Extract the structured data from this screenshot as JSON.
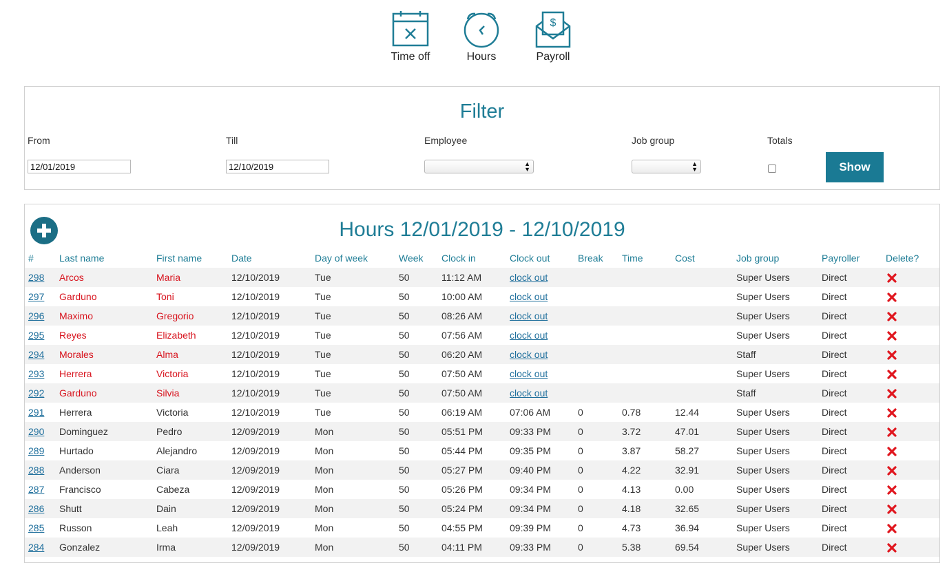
{
  "nav": [
    {
      "label": "Time off",
      "icon": "calendar-x-icon"
    },
    {
      "label": "Hours",
      "icon": "clock-icon"
    },
    {
      "label": "Payroll",
      "icon": "payroll-envelope-icon"
    }
  ],
  "filter": {
    "title": "Filter",
    "from_label": "From",
    "from_value": "12/01/2019",
    "till_label": "Till",
    "till_value": "12/10/2019",
    "employee_label": "Employee",
    "employee_value": "",
    "job_group_label": "Job group",
    "job_group_value": "",
    "totals_label": "Totals",
    "totals_checked": false,
    "show_label": "Show"
  },
  "hours": {
    "title": "Hours 12/01/2019 - 12/10/2019",
    "columns": [
      "#",
      "Last name",
      "First name",
      "Date",
      "Day of week",
      "Week",
      "Clock in",
      "Clock out",
      "Break",
      "Time",
      "Cost",
      "Job group",
      "Payroller",
      "Delete?"
    ],
    "rows": [
      {
        "id": "298",
        "last": "Arcos",
        "first": "Maria",
        "date": "12/10/2019",
        "dow": "Tue",
        "week": "50",
        "in": "11:12 AM",
        "out": "clock out",
        "brk": "",
        "time": "",
        "cost": "",
        "group": "Super Users",
        "payroller": "Direct",
        "open": true
      },
      {
        "id": "297",
        "last": "Garduno",
        "first": "Toni",
        "date": "12/10/2019",
        "dow": "Tue",
        "week": "50",
        "in": "10:00 AM",
        "out": "clock out",
        "brk": "",
        "time": "",
        "cost": "",
        "group": "Super Users",
        "payroller": "Direct",
        "open": true
      },
      {
        "id": "296",
        "last": "Maximo",
        "first": "Gregorio",
        "date": "12/10/2019",
        "dow": "Tue",
        "week": "50",
        "in": "08:26 AM",
        "out": "clock out",
        "brk": "",
        "time": "",
        "cost": "",
        "group": "Super Users",
        "payroller": "Direct",
        "open": true
      },
      {
        "id": "295",
        "last": "Reyes",
        "first": "Elizabeth",
        "date": "12/10/2019",
        "dow": "Tue",
        "week": "50",
        "in": "07:56 AM",
        "out": "clock out",
        "brk": "",
        "time": "",
        "cost": "",
        "group": "Super Users",
        "payroller": "Direct",
        "open": true
      },
      {
        "id": "294",
        "last": "Morales",
        "first": "Alma",
        "date": "12/10/2019",
        "dow": "Tue",
        "week": "50",
        "in": "06:20 AM",
        "out": "clock out",
        "brk": "",
        "time": "",
        "cost": "",
        "group": "Staff",
        "payroller": "Direct",
        "open": true
      },
      {
        "id": "293",
        "last": "Herrera",
        "first": "Victoria",
        "date": "12/10/2019",
        "dow": "Tue",
        "week": "50",
        "in": "07:50 AM",
        "out": "clock out",
        "brk": "",
        "time": "",
        "cost": "",
        "group": "Super Users",
        "payroller": "Direct",
        "open": true
      },
      {
        "id": "292",
        "last": "Garduno",
        "first": "Silvia",
        "date": "12/10/2019",
        "dow": "Tue",
        "week": "50",
        "in": "07:50 AM",
        "out": "clock out",
        "brk": "",
        "time": "",
        "cost": "",
        "group": "Staff",
        "payroller": "Direct",
        "open": true
      },
      {
        "id": "291",
        "last": "Herrera",
        "first": "Victoria",
        "date": "12/10/2019",
        "dow": "Tue",
        "week": "50",
        "in": "06:19 AM",
        "out": "07:06 AM",
        "brk": "0",
        "time": "0.78",
        "cost": "12.44",
        "group": "Super Users",
        "payroller": "Direct",
        "open": false
      },
      {
        "id": "290",
        "last": "Dominguez",
        "first": "Pedro",
        "date": "12/09/2019",
        "dow": "Mon",
        "week": "50",
        "in": "05:51 PM",
        "out": "09:33 PM",
        "brk": "0",
        "time": "3.72",
        "cost": "47.01",
        "group": "Super Users",
        "payroller": "Direct",
        "open": false
      },
      {
        "id": "289",
        "last": "Hurtado",
        "first": "Alejandro",
        "date": "12/09/2019",
        "dow": "Mon",
        "week": "50",
        "in": "05:44 PM",
        "out": "09:35 PM",
        "brk": "0",
        "time": "3.87",
        "cost": "58.27",
        "group": "Super Users",
        "payroller": "Direct",
        "open": false
      },
      {
        "id": "288",
        "last": "Anderson",
        "first": "Ciara",
        "date": "12/09/2019",
        "dow": "Mon",
        "week": "50",
        "in": "05:27 PM",
        "out": "09:40 PM",
        "brk": "0",
        "time": "4.22",
        "cost": "32.91",
        "group": "Super Users",
        "payroller": "Direct",
        "open": false
      },
      {
        "id": "287",
        "last": "Francisco",
        "first": "Cabeza",
        "date": "12/09/2019",
        "dow": "Mon",
        "week": "50",
        "in": "05:26 PM",
        "out": "09:34 PM",
        "brk": "0",
        "time": "4.13",
        "cost": "0.00",
        "group": "Super Users",
        "payroller": "Direct",
        "open": false
      },
      {
        "id": "286",
        "last": "Shutt",
        "first": "Dain",
        "date": "12/09/2019",
        "dow": "Mon",
        "week": "50",
        "in": "05:24 PM",
        "out": "09:34 PM",
        "brk": "0",
        "time": "4.18",
        "cost": "32.65",
        "group": "Super Users",
        "payroller": "Direct",
        "open": false
      },
      {
        "id": "285",
        "last": "Russon",
        "first": "Leah",
        "date": "12/09/2019",
        "dow": "Mon",
        "week": "50",
        "in": "04:55 PM",
        "out": "09:39 PM",
        "brk": "0",
        "time": "4.73",
        "cost": "36.94",
        "group": "Super Users",
        "payroller": "Direct",
        "open": false
      },
      {
        "id": "284",
        "last": "Gonzalez",
        "first": "Irma",
        "date": "12/09/2019",
        "dow": "Mon",
        "week": "50",
        "in": "04:11 PM",
        "out": "09:33 PM",
        "brk": "0",
        "time": "5.38",
        "cost": "69.54",
        "group": "Super Users",
        "payroller": "Direct",
        "open": false
      }
    ]
  },
  "colors": {
    "accent": "#1f7d96",
    "button": "#1a7a94",
    "open_shift": "#d8141e",
    "link": "#1f6f9c",
    "delete": "#e0161e"
  }
}
